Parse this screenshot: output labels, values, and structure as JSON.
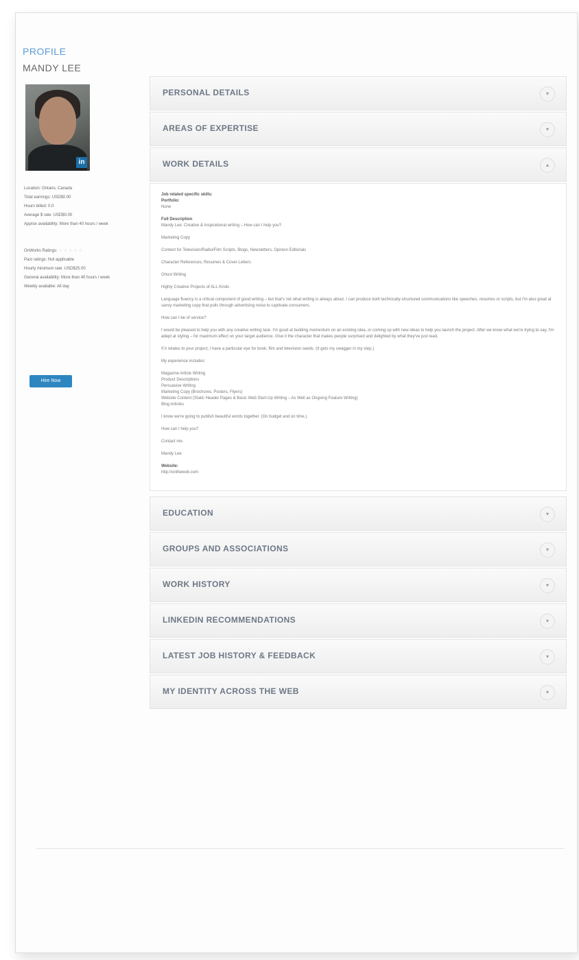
{
  "profile": {
    "label": "PROFILE",
    "name": "MANDY LEE"
  },
  "avatar": {
    "badge": "in"
  },
  "sidebar": {
    "location": "Location: Ontario, Canada",
    "total_earnings": "Total earnings: USD$0.00",
    "hours_billed": "Hours billed: 0.0",
    "average_rate": "Average $ rate: USD$0.00",
    "approx_availability": "Approx availability: More than 40 hours / week",
    "ratings": "OnWorks Ratings:",
    "stars": "☆☆☆☆☆",
    "past_ratings": "Past ratings: Not applicable",
    "hourly_rate": "Hourly minimum rate: USD$25.00",
    "general_availability": "General availability: More than 40 hours / week",
    "weekly_available": "Weekly available: All day",
    "button_label": "Hire Now"
  },
  "accordions_top": [
    {
      "title": "PERSONAL DETAILS",
      "icon": "chevron-down-icon"
    },
    {
      "title": "AREAS OF EXPERTISE",
      "icon": "chevron-down-icon"
    },
    {
      "title": "WORK DETAILS",
      "icon": "chevron-up-icon"
    }
  ],
  "work_details": {
    "skills_label": "Job related specific skills:",
    "portfolio_label": "Portfolio:",
    "portfolio_value": "None",
    "full_description_label": "Full Description",
    "lines": [
      "Mandy Lee: Creative & Inspirational writing – How can I help you?",
      "Marketing Copy",
      "Content for Television/Radio/Film Scripts, Blogs, Newsletters, Opinion Editorials",
      "Character References, Resumes & Cover Letters",
      "Ghost Writing",
      "Highly Creative Projects of ALL Kinds",
      "Language fluency is a critical component of good writing – but that's not what writing is always about. I can produce both technically-structured communications like speeches, resumes or scripts, but I'm also great at savvy marketing copy that pulls through advertising noise to captivate consumers.",
      "How can I be of service?",
      "I would be pleased to help you with any creative writing task. I'm good at building momentum on an existing idea, or coming up with new ideas to help you launch the project. After we know what we're trying to say, I'm adept at styling – for maximum effect on your target audience. Give it the character that makes people surprised and delighted by what they've just read.",
      "If it relates to your project, I have a particular eye for book, film and television seeds. (It gets my swagger in my step.)",
      "My experience includes:",
      "Magazine Article Writing\nProduct Descriptions\nPersuasive Writing\nMarketing Copy (Brochures, Posters, Flyers)\nWebsite Content (Static Header Pages & Basic Web Start-Up Writing – As Well as Ongoing Feature Writing)\nBlog Articles",
      "I know we're going to publish beautiful words together. (On budget and on time.)",
      "How can I help you?",
      "Contact me.",
      "Mandy Lee"
    ],
    "website_label": "Website:",
    "website_value": "http://ontheweb.com"
  },
  "accordions_bottom": [
    {
      "title": "EDUCATION",
      "icon": "chevron-down-icon"
    },
    {
      "title": "GROUPS AND ASSOCIATIONS",
      "icon": "chevron-down-icon"
    },
    {
      "title": "WORK HISTORY",
      "icon": "chevron-down-icon"
    },
    {
      "title": "LINKEDIN RECOMMENDATIONS",
      "icon": "chevron-down-icon"
    },
    {
      "title": "LATEST JOB HISTORY & FEEDBACK",
      "icon": "chevron-down-icon"
    },
    {
      "title": "MY IDENTITY ACROSS THE WEB",
      "icon": "chevron-down-icon"
    }
  ]
}
